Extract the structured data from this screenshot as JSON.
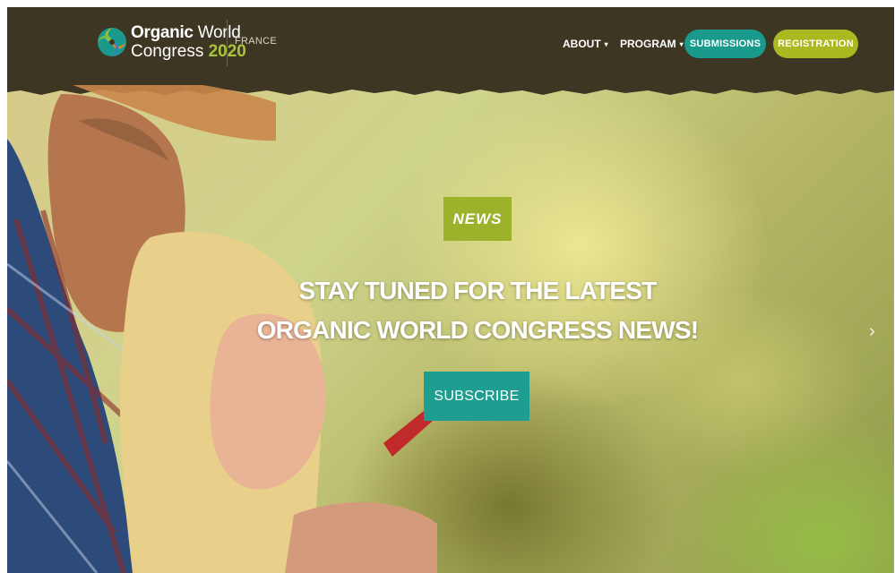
{
  "header": {
    "logo": {
      "line1_bold": "Organic",
      "line1_light": "World",
      "line2_text": "Congress",
      "line2_year": "2020"
    },
    "country": "FRANCE",
    "nav": {
      "about": "ABOUT",
      "program": "PROGRAM"
    },
    "submissions_label": "SUBMISSIONS",
    "registration_label": "REGISTRATION"
  },
  "hero": {
    "badge": "NEWS",
    "headline_line1": "STAY TUNED FOR THE LATEST",
    "headline_line2": "ORGANIC WORLD CONGRESS NEWS!",
    "subscribe_label": "SUBSCRIBE",
    "next_arrow": "›"
  },
  "colors": {
    "header_bg": "#3d3623",
    "teal": "#1a9a8c",
    "olive": "#a9b91f",
    "year_green": "#a8c43a"
  },
  "icons": {
    "logo": "organic-world-congress-logo",
    "caret": "caret-down-icon",
    "next": "chevron-right-icon"
  }
}
